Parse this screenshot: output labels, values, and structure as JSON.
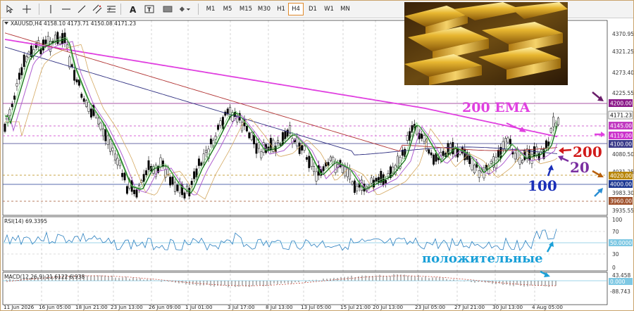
{
  "toolbar": {
    "timeframes": [
      "M1",
      "M5",
      "M15",
      "M30",
      "H1",
      "H4",
      "D1",
      "W1",
      "MN"
    ],
    "active_timeframe": "H4",
    "icons": [
      "cursor-arrow-icon",
      "crosshair-icon",
      "vertical-line-icon",
      "horizontal-line-icon",
      "trendline-icon",
      "equidistant-channel-icon",
      "fibonacci-icon",
      "text-label-icon",
      "text-box-icon",
      "rectangle-icon",
      "shapes-dropdown-icon"
    ]
  },
  "chart": {
    "header": "XAUUSD,H4  4158.10 4173.71 4150.08 4171.23",
    "price_levels": {
      "p4370": "4370.95",
      "p4321": "4321.25",
      "p4273": "4273.40",
      "p4225": "4225.55",
      "p4200": "4200.00",
      "p4171": "4171.23",
      "p4145": "4145.00",
      "p4119": "4119.00",
      "p4100": "4100.00",
      "p4080": "4080.50",
      "p4031": "4031.25",
      "p4020": "4020.00",
      "p4000": "4000.00",
      "p3983": "3983.30",
      "p3960": "3960.00",
      "p3935": "3935.55"
    },
    "time_labels": [
      "11 Jun 2026",
      "16 Jun 05:00",
      "18 Jun 21:00",
      "23 Jun 13:00",
      "26 Jun 09:00",
      "1 Jul 01:00",
      "3 Jul 17:00",
      "8 Jul 13:00",
      "13 Jul 05:00",
      "15 Jul 21:00",
      "20 Jul 13:00",
      "23 Jul 05:00",
      "27 Jul 21:00",
      "30 Jul 13:00",
      "4 Aug 05:00"
    ],
    "colors": {
      "level_4200": "#8b1a89",
      "level_4145": "#c13bc1",
      "level_4119": "#cc33cc",
      "level_4100": "#3a3a8a",
      "level_4020": "#b8860b",
      "level_4000": "#1f3a93",
      "level_3960": "#a0522d",
      "ema200": "#e040e0",
      "ema100": "#2e2e80",
      "ema20": "#7a2fa0",
      "sma_red": "#b03030",
      "green_ma": "#1a7a1a"
    }
  },
  "annotations": {
    "ema200_label": "200 EMA",
    "label_200": "200",
    "label_20": "20",
    "label_100": "100",
    "rsi_note": "положительные"
  },
  "rsi": {
    "header": "RSI(14) 69.3395",
    "levels": {
      "r100": "100",
      "r70": "70",
      "r50": "50.0000",
      "r30": "30",
      "r0": "0"
    }
  },
  "macd": {
    "header": "MACD(12,26,9) 21.6122 6.938",
    "levels": {
      "m1": "43.458",
      "m2": "0.000",
      "m3": "-88.743"
    }
  }
}
